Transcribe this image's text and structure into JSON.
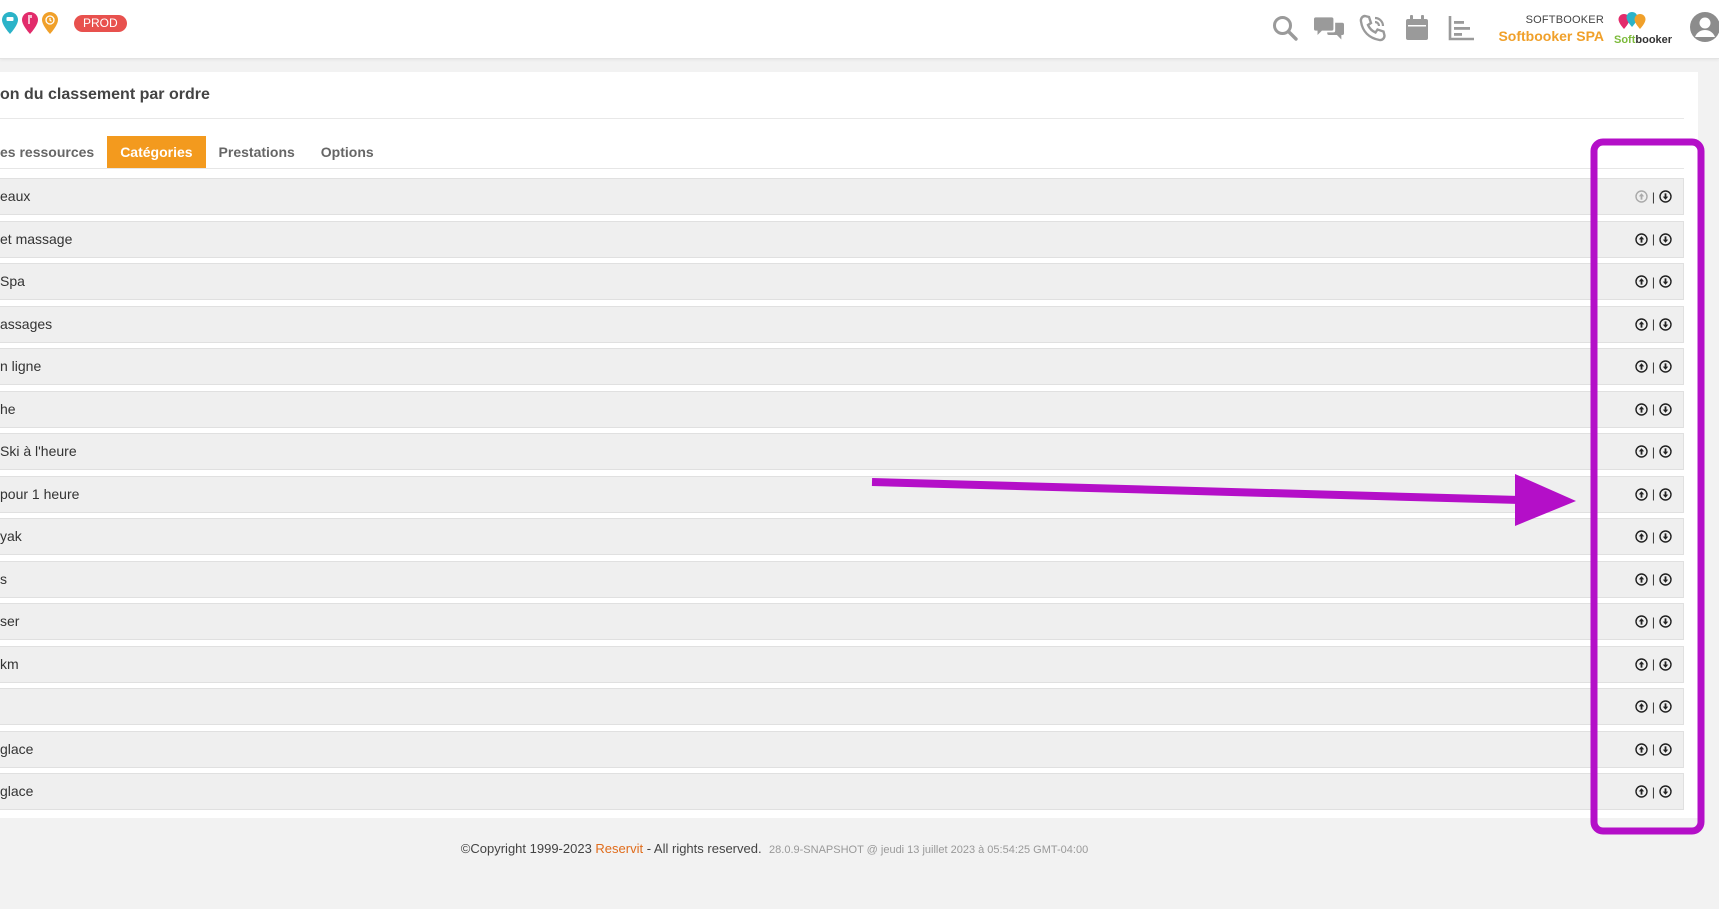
{
  "header": {
    "env_badge": "PROD",
    "icons": [
      "search-icon",
      "chat-icon",
      "phone-icon",
      "calendar-icon",
      "report-icon"
    ],
    "account_label": "SOFTBOOKER",
    "account_name": "Softbooker SPA",
    "brand_soft": "Soft",
    "brand_booker": "booker",
    "colors": {
      "accent": "#f39a1e",
      "badge": "#e8514e",
      "account": "#f0a02a"
    }
  },
  "panel": {
    "title": "on du classement par ordre",
    "tabs": [
      {
        "label": "es ressources",
        "active": false
      },
      {
        "label": "Catégories",
        "active": true
      },
      {
        "label": "Prestations",
        "active": false
      },
      {
        "label": "Options",
        "active": false
      }
    ],
    "rows": [
      {
        "label": "eaux",
        "up_disabled": true
      },
      {
        "label": "et massage",
        "up_disabled": false
      },
      {
        "label": "Spa",
        "up_disabled": false
      },
      {
        "label": "assages",
        "up_disabled": false
      },
      {
        "label": "n ligne",
        "up_disabled": false
      },
      {
        "label": "he",
        "up_disabled": false
      },
      {
        "label": "Ski à l'heure",
        "up_disabled": false
      },
      {
        "label": "pour 1 heure",
        "up_disabled": false
      },
      {
        "label": "yak",
        "up_disabled": false
      },
      {
        "label": "s",
        "up_disabled": false
      },
      {
        "label": "ser",
        "up_disabled": false
      },
      {
        "label": "km",
        "up_disabled": false
      },
      {
        "label": "",
        "up_disabled": false
      },
      {
        "label": "glace",
        "up_disabled": false
      },
      {
        "label": "glace",
        "up_disabled": false
      }
    ],
    "separator": "|"
  },
  "footer": {
    "copyright": "©Copyright 1999-2023 ",
    "link": "Reservit",
    "rights": " - All rights reserved.",
    "version": "28.0.9-SNAPSHOT @ jeudi 13 juillet 2023 à 05:54:25 GMT-04:00"
  },
  "annotation": {
    "color": "#b40fc8"
  }
}
